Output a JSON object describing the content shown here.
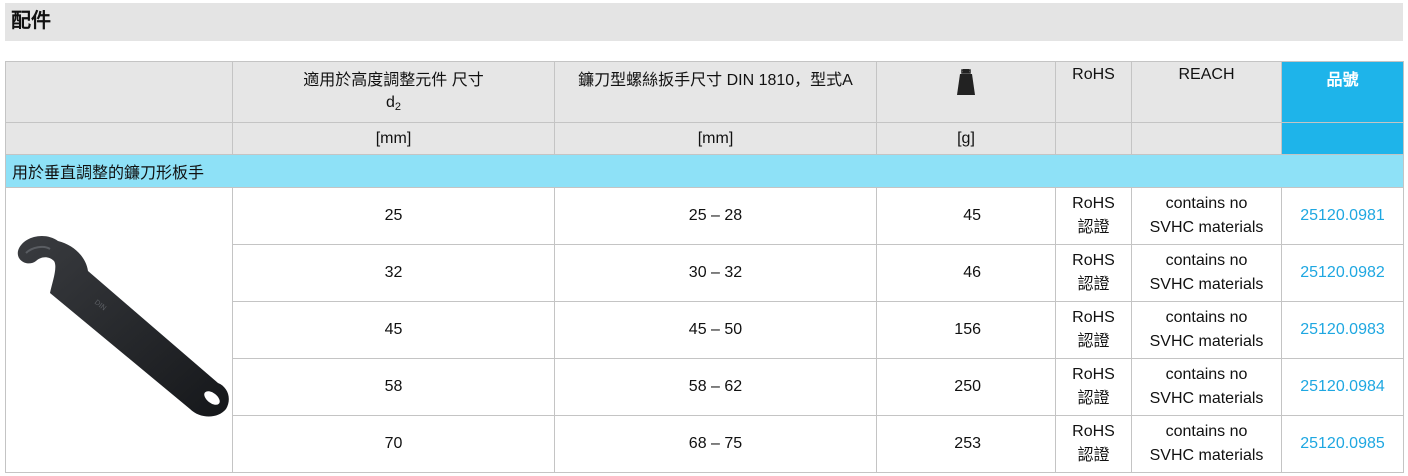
{
  "page": {
    "title": "配件"
  },
  "table": {
    "headers": {
      "col_d2_text": "適用於高度調整元件 尺寸",
      "col_d2_symbol": "d",
      "col_d2_subscript": "2",
      "col_wrench": "鐮刀型螺絲扳手尺寸 DIN 1810，型式A",
      "col_weight_icon": "weight-icon",
      "col_rohs": "RoHS",
      "col_reach": "REACH",
      "col_order": "品號"
    },
    "units": {
      "d2": "[mm]",
      "wrench": "[mm]",
      "weight": "[g]"
    },
    "group_title": "用於垂直調整的鐮刀形板手",
    "image_icon": "hook-spanner-wrench",
    "rows": [
      {
        "d2": "25",
        "wrench": "25 – 28",
        "weight": "45",
        "rohs_1": "RoHS",
        "rohs_2": "認證",
        "reach_1": "contains no",
        "reach_2": "SVHC materials",
        "order": "25120.0981"
      },
      {
        "d2": "32",
        "wrench": "30 – 32",
        "weight": "46",
        "rohs_1": "RoHS",
        "rohs_2": "認證",
        "reach_1": "contains no",
        "reach_2": "SVHC materials",
        "order": "25120.0982"
      },
      {
        "d2": "45",
        "wrench": "45 – 50",
        "weight": "156",
        "rohs_1": "RoHS",
        "rohs_2": "認證",
        "reach_1": "contains no",
        "reach_2": "SVHC materials",
        "order": "25120.0983"
      },
      {
        "d2": "58",
        "wrench": "58 – 62",
        "weight": "250",
        "rohs_1": "RoHS",
        "rohs_2": "認證",
        "reach_1": "contains no",
        "reach_2": "SVHC materials",
        "order": "25120.0984"
      },
      {
        "d2": "70",
        "wrench": "68 – 75",
        "weight": "253",
        "rohs_1": "RoHS",
        "rohs_2": "認證",
        "reach_1": "contains no",
        "reach_2": "SVHC materials",
        "order": "25120.0985"
      }
    ]
  },
  "colors": {
    "header_bg": "#e6e6e6",
    "order_header_bg": "#1eb4ea",
    "group_bg": "#8ee1f7",
    "order_link": "#1ea7e1",
    "title_bar_bg": "#e4e4e4"
  }
}
